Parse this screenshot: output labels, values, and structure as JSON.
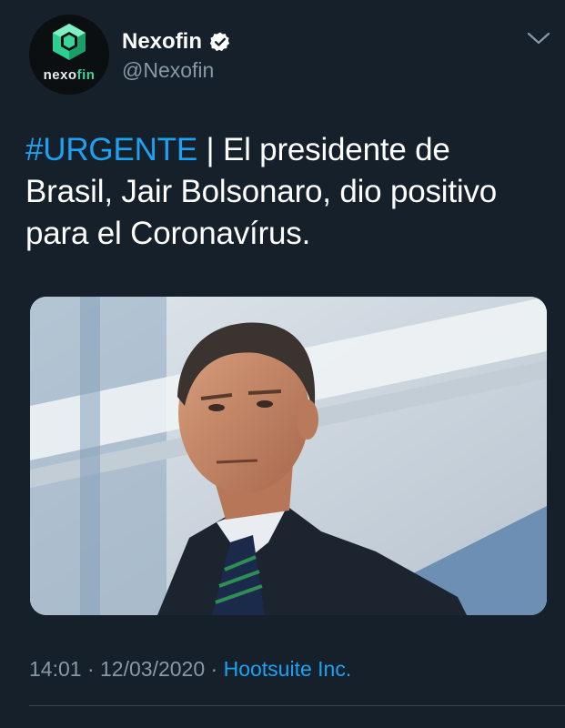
{
  "account": {
    "display_name": "Nexofin",
    "handle": "@Nexofin",
    "logo_text_main": "nexo",
    "logo_text_accent": "fin",
    "verified": true
  },
  "tweet": {
    "hashtag": "#URGENTE",
    "text": " | El presidente de Brasil, Jair Bolsonaro, dio positivo para el Coronavírus."
  },
  "meta": {
    "time": "14:01",
    "separator": "·",
    "date": "12/03/2020",
    "source": "Hootsuite Inc."
  },
  "colors": {
    "background": "#15202b",
    "accent": "#1da1f2",
    "muted": "#8899a6",
    "logo_accent": "#38d69a"
  },
  "icons": {
    "verified": "verified-badge-icon",
    "menu": "chevron-down-icon"
  }
}
